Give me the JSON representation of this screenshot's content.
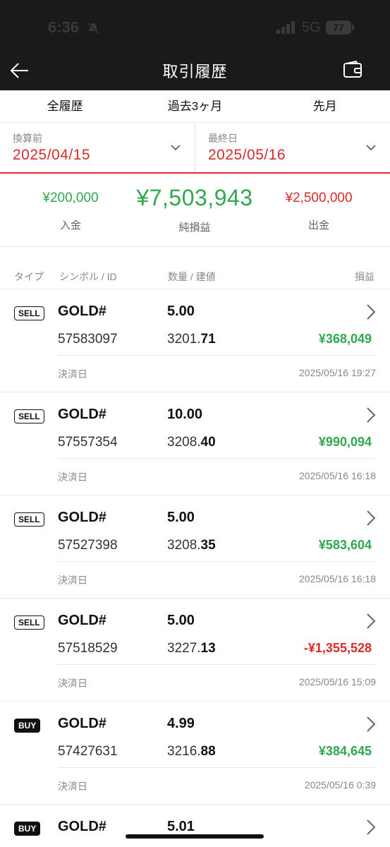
{
  "status_bar": {
    "time": "6:36",
    "network": "5G",
    "battery": "77"
  },
  "header": {
    "title": "取引履歴"
  },
  "range_tabs": [
    {
      "label": "全履歴"
    },
    {
      "label": "過去3ヶ月"
    },
    {
      "label": "先月"
    }
  ],
  "date_filter": {
    "start": {
      "caption": "換算前",
      "value": "2025/04/15"
    },
    "end": {
      "caption": "最終日",
      "value": "2025/05/16"
    }
  },
  "summary": {
    "deposit": {
      "value": "¥200,000",
      "label": "入金"
    },
    "net": {
      "value": "¥7,503,943",
      "label": "純損益"
    },
    "withdraw": {
      "value": "¥2,500,000",
      "label": "出金"
    }
  },
  "table_headers": {
    "type": "タイプ",
    "symbol": "シンボル / ID",
    "qty": "数量 / 建値",
    "pl": "損益"
  },
  "colors": {
    "accent_red": "#d92b2b",
    "profit_green": "#2fa84f",
    "header_bg": "#1a1a1a"
  },
  "trades": [
    {
      "type": "SELL",
      "symbol": "GOLD#",
      "qty": "5.00",
      "id": "57583097",
      "price_int": "3201.",
      "price_dec": "71",
      "pl": "¥368,049",
      "pl_sign": "positive",
      "settle_label": "決済日",
      "settle_date": "2025/05/16 19:27"
    },
    {
      "type": "SELL",
      "symbol": "GOLD#",
      "qty": "10.00",
      "id": "57557354",
      "price_int": "3208.",
      "price_dec": "40",
      "pl": "¥990,094",
      "pl_sign": "positive",
      "settle_label": "決済日",
      "settle_date": "2025/05/16 16:18"
    },
    {
      "type": "SELL",
      "symbol": "GOLD#",
      "qty": "5.00",
      "id": "57527398",
      "price_int": "3208.",
      "price_dec": "35",
      "pl": "¥583,604",
      "pl_sign": "positive",
      "settle_label": "決済日",
      "settle_date": "2025/05/16 16:18"
    },
    {
      "type": "SELL",
      "symbol": "GOLD#",
      "qty": "5.00",
      "id": "57518529",
      "price_int": "3227.",
      "price_dec": "13",
      "pl": "-¥1,355,528",
      "pl_sign": "negative",
      "settle_label": "決済日",
      "settle_date": "2025/05/16 15:09"
    },
    {
      "type": "BUY",
      "symbol": "GOLD#",
      "qty": "4.99",
      "id": "57427631",
      "price_int": "3216.",
      "price_dec": "88",
      "pl": "¥384,645",
      "pl_sign": "positive",
      "settle_label": "決済日",
      "settle_date": "2025/05/16 0:39"
    },
    {
      "type": "BUY",
      "symbol": "GOLD#",
      "qty": "5.01"
    }
  ]
}
